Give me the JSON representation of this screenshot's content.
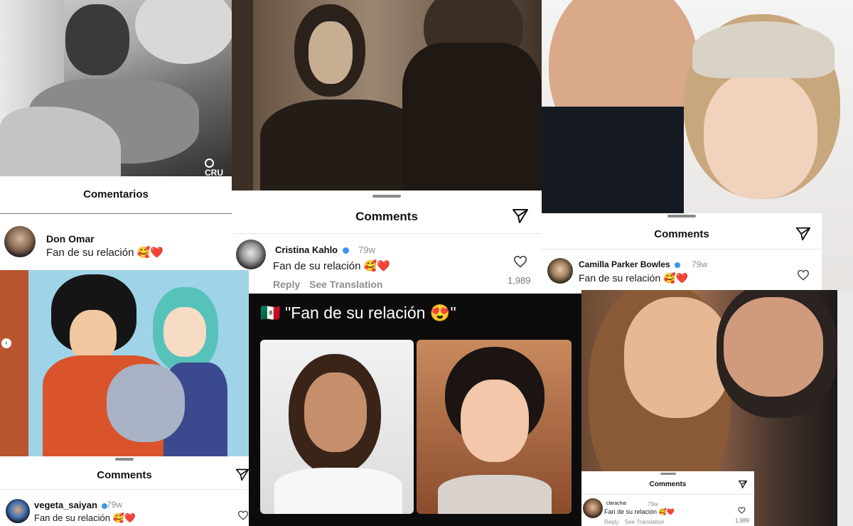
{
  "panels": {
    "don_omar": {
      "sheet_title": "Comentarios",
      "username": "Don Omar",
      "comment": "Fan de su relación 🥰❤️",
      "watermark": "CRU"
    },
    "cristina_kahlo": {
      "sheet_title": "Comments",
      "username": "Cristina Kahlo",
      "time": "79w",
      "comment": "Fan de su relación 🥰❤️",
      "likes": "1,989",
      "reply": "Reply",
      "see_translation": "See Translation"
    },
    "camilla": {
      "sheet_title": "Comments",
      "username": "Camilla Parker Bowles",
      "time": "79w",
      "comment": "Fan de su relación 🥰❤️"
    },
    "vegeta": {
      "sheet_title": "Comments",
      "username": "vegeta_saiyan",
      "time": "79w",
      "comment": "Fan de su relación 🥰❤️"
    },
    "news": {
      "caption_flag": "🇲🇽",
      "caption_text": "\"Fan de su relación 😍\""
    },
    "clarachia": {
      "sheet_title": "Comments",
      "username": "clarachia",
      "time": "79w",
      "comment": "Fan de su relación 🥰❤️",
      "likes": "1,989",
      "reply": "Reply",
      "see_translation": "See Translation"
    }
  },
  "colors": {
    "verified": "#3897f0",
    "dark_bg": "#0c0c0c"
  }
}
